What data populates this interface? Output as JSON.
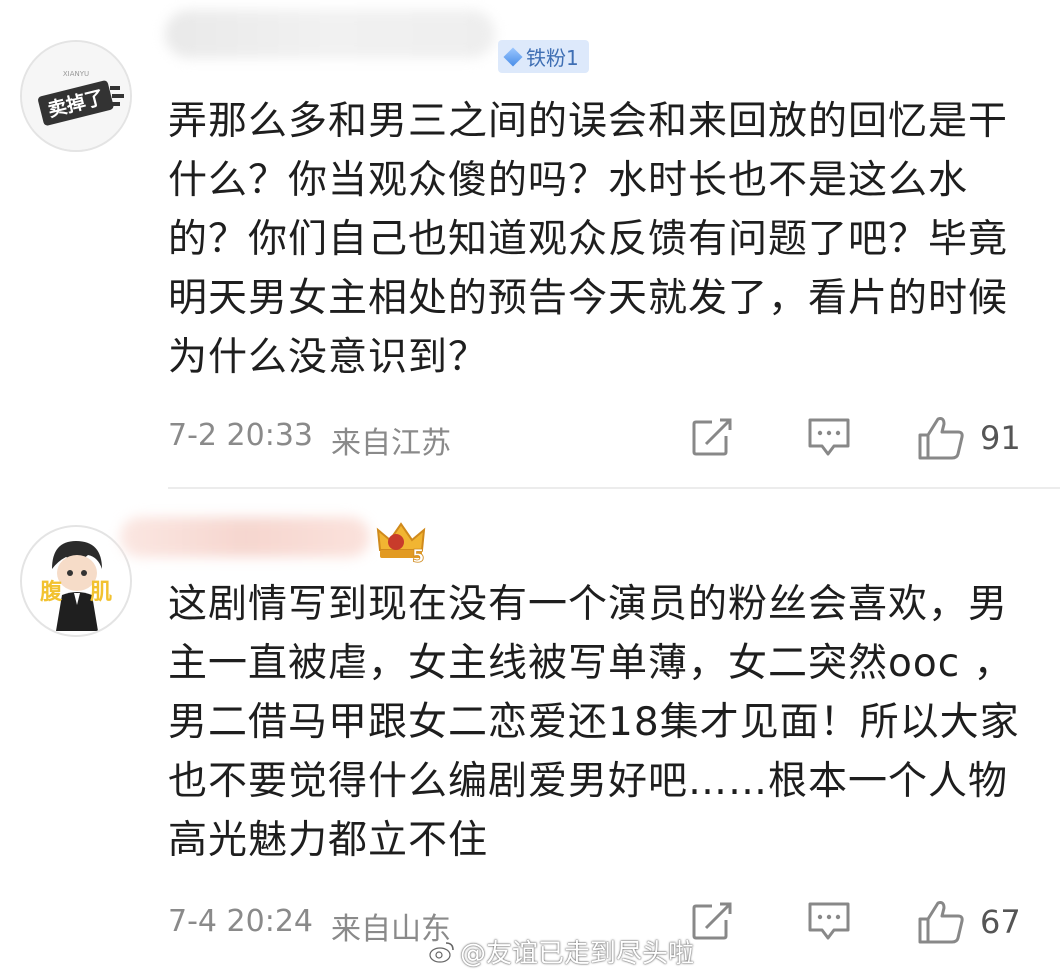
{
  "comments": [
    {
      "avatar_text": "卖掉了",
      "avatar_small_text": "XIANYU",
      "fan_badge": "铁粉1",
      "text": "弄那么多和男三之间的误会和来回放的回忆是干什么？你当观众傻的吗？水时长也不是这么水的？你们自己也知道观众反馈有问题了吧？毕竟明天男女主相处的预告今天就发了，看片的时候为什么没意识到？",
      "time": "7-2 20:33",
      "location": "来自江苏",
      "likes": "91"
    },
    {
      "avatar_text_left": "腹",
      "avatar_text_right": "肌",
      "vip_level": "5",
      "text": "这剧情写到现在没有一个演员的粉丝会喜欢，男主一直被虐，女主线被写单薄，女二突然ooc ，男二借马甲跟女二恋爱还18集才见面！所以大家也不要觉得什么编剧爱男好吧……根本一个人物高光魅力都立不住",
      "time": "7-4 20:24",
      "location": "来自山东",
      "likes": "67"
    }
  ],
  "icons": {
    "share": "share-icon",
    "comment": "comment-icon",
    "like": "thumbs-up-icon"
  },
  "watermark": "@友谊已走到尽头啦",
  "colors": {
    "meta_text": "#8a8a8a",
    "fan_badge_bg": "#dde9fb",
    "fan_badge_text": "#3f6fb4",
    "divider": "#ececec"
  }
}
